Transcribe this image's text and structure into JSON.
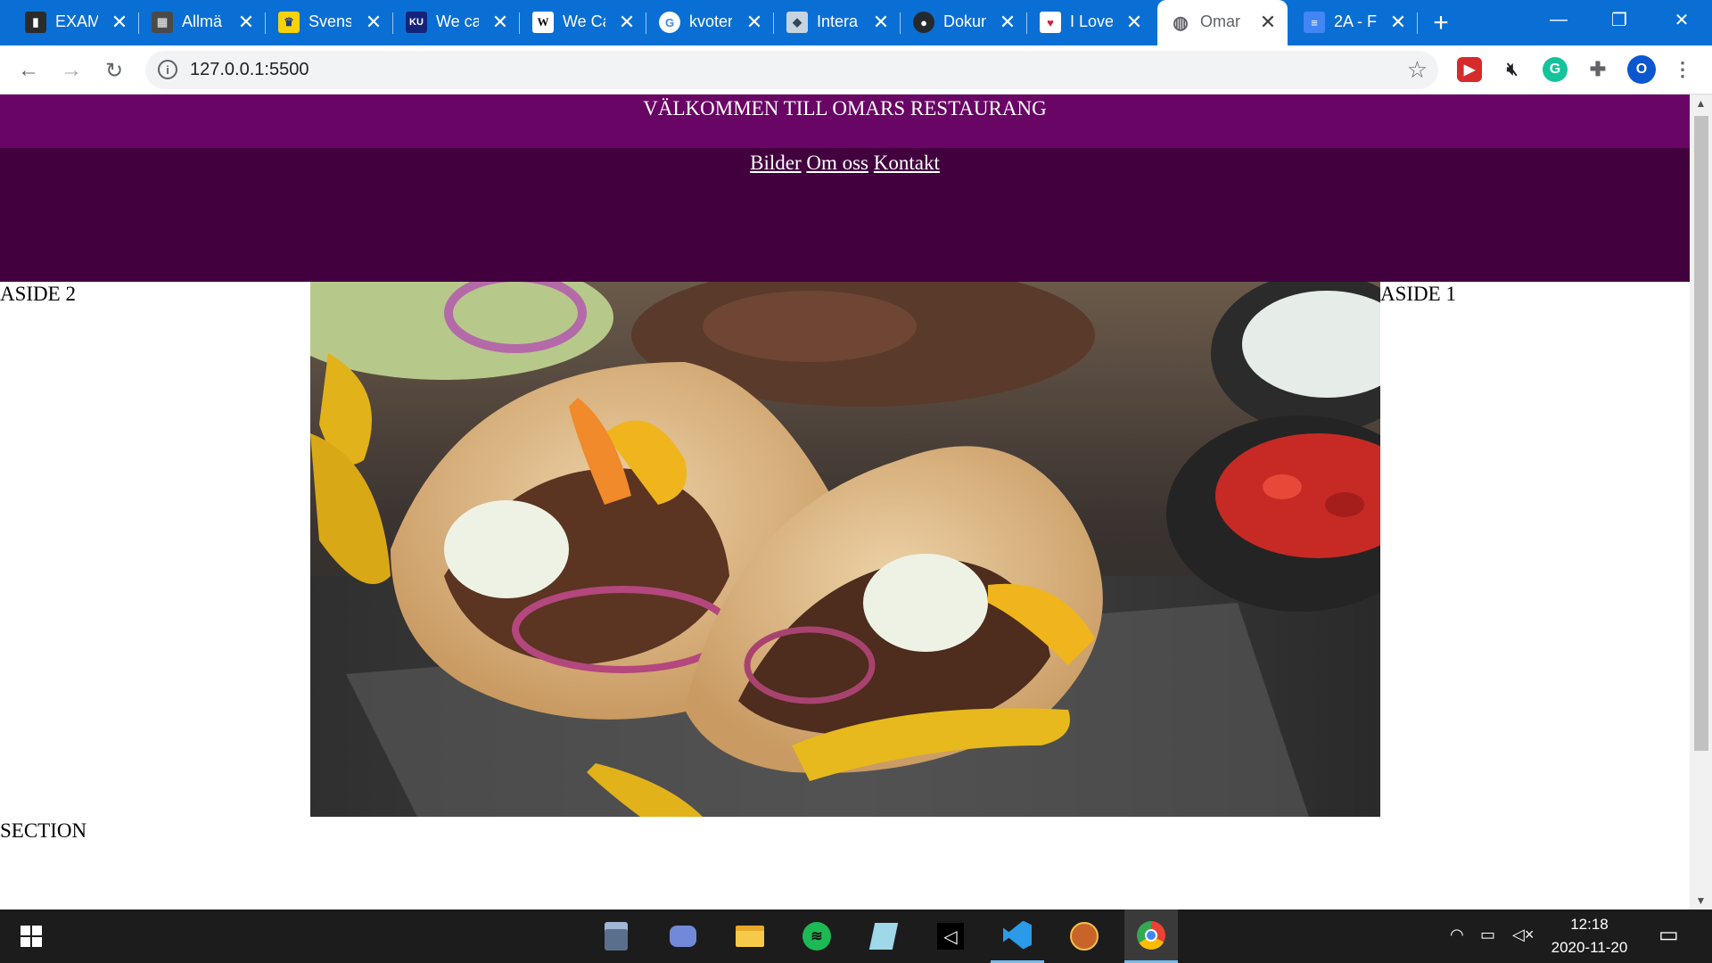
{
  "browser": {
    "tabs": [
      {
        "title": "EXAM",
        "favicon": "exam-icon",
        "active": false
      },
      {
        "title": "Allmä",
        "favicon": "allman-icon",
        "active": false
      },
      {
        "title": "Svensk",
        "favicon": "svensk-crest-icon",
        "active": false
      },
      {
        "title": "We ca",
        "favicon": "ku-icon",
        "active": false
      },
      {
        "title": "We Ca",
        "favicon": "wikipedia-icon",
        "active": false
      },
      {
        "title": "kvoter",
        "favicon": "google-icon",
        "active": false
      },
      {
        "title": "Intera",
        "favicon": "cube-icon",
        "active": false
      },
      {
        "title": "Dokum",
        "favicon": "github-icon",
        "active": false
      },
      {
        "title": "I Love",
        "favicon": "heart-icon",
        "active": false
      },
      {
        "title": "Omar",
        "favicon": "globe-icon",
        "active": true
      },
      {
        "title": "2A - F",
        "favicon": "docs-icon",
        "active": false
      }
    ],
    "url": "127.0.0.1:5500"
  },
  "page": {
    "header_title": "VÄLKOMMEN TILL OMARS RESTAURANG",
    "nav": [
      "Bilder",
      "Om oss",
      "Kontakt"
    ],
    "aside_left": "ASIDE 2",
    "aside_right": "ASIDE 1",
    "section": "SECTION",
    "hero_image": "gyros-pita-photo",
    "colors": {
      "header_top": "#690565",
      "header_nav": "#42003f"
    }
  },
  "taskbar": {
    "apps": [
      "calculator-icon",
      "discord-icon",
      "file-explorer-icon",
      "spotify-icon",
      "notepad-icon",
      "unity-icon",
      "vscode-icon",
      "shoes-game-icon",
      "chrome-icon"
    ],
    "time": "12:18",
    "date": "2020-11-20"
  }
}
